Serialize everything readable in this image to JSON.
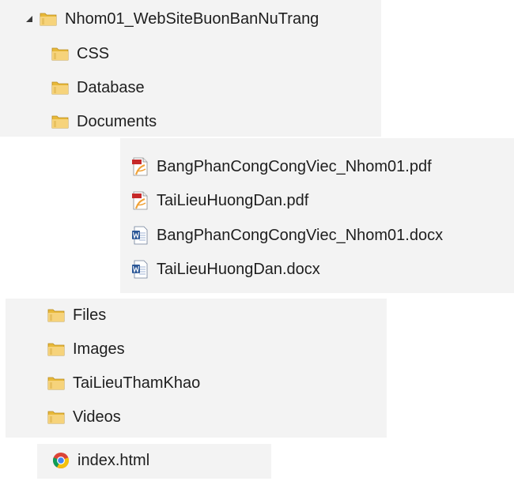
{
  "tree": {
    "root": {
      "label": "Nhom01_WebSiteBuonBanNuTrang",
      "icon": "folder-icon",
      "expanded": true
    },
    "folders_top": [
      {
        "label": "CSS",
        "icon": "folder-icon"
      },
      {
        "label": "Database",
        "icon": "folder-icon"
      },
      {
        "label": "Documents",
        "icon": "folder-icon"
      }
    ],
    "documents": [
      {
        "label": "BangPhanCongCongViec_Nhom01.pdf",
        "icon": "pdf-icon"
      },
      {
        "label": "TaiLieuHuongDan.pdf",
        "icon": "pdf-icon"
      },
      {
        "label": "BangPhanCongCongViec_Nhom01.docx",
        "icon": "word-icon"
      },
      {
        "label": "TaiLieuHuongDan.docx",
        "icon": "word-icon"
      }
    ],
    "folders_bottom": [
      {
        "label": "Files",
        "icon": "folder-icon"
      },
      {
        "label": "Images",
        "icon": "folder-icon"
      },
      {
        "label": "TaiLieuThamKhao",
        "icon": "folder-icon"
      },
      {
        "label": "Videos",
        "icon": "folder-icon"
      }
    ],
    "index_file": {
      "label": "index.html",
      "icon": "chrome-icon"
    }
  },
  "colors": {
    "panel_background": "#f3f3f3",
    "folder_yellow": "#f4d27a",
    "text": "#1e1e1e"
  }
}
